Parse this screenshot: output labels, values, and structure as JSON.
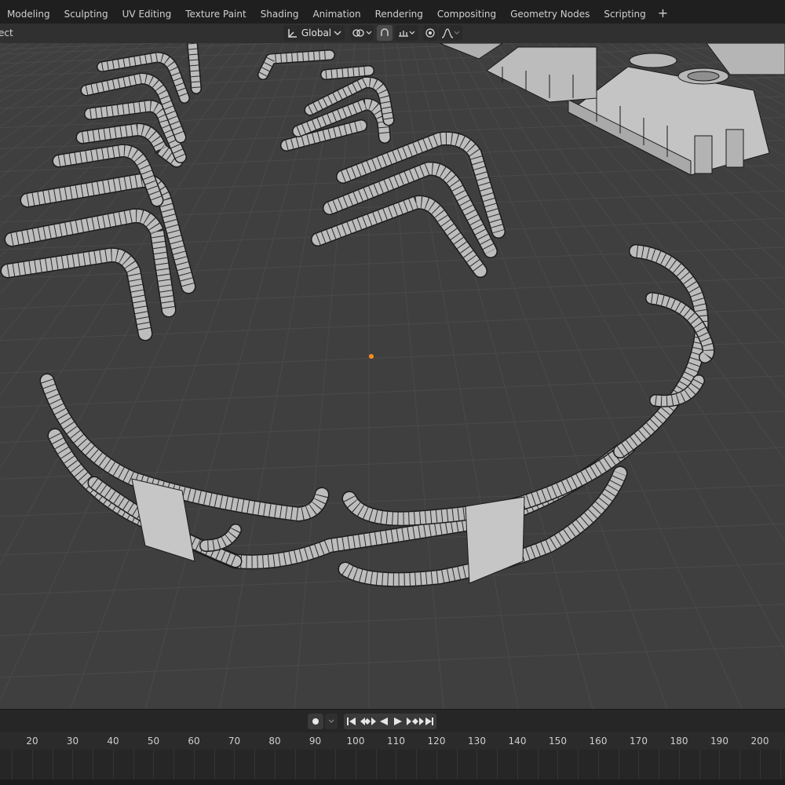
{
  "workspace_tabs": [
    "Modeling",
    "Sculpting",
    "UV Editing",
    "Texture Paint",
    "Shading",
    "Animation",
    "Rendering",
    "Compositing",
    "Geometry Nodes",
    "Scripting"
  ],
  "add_tab_label": "+",
  "header": {
    "mode_text": "ect",
    "transform_orientation": "Global",
    "orientation_icon": "transform-orientation-icon",
    "pivot_icon": "pivot-point-icon",
    "snap_icon": "snap-magnet-icon",
    "snap_target_icon": "snap-increment-icon",
    "proportional_icon": "proportional-editing-icon",
    "falloff_icon": "falloff-curve-icon"
  },
  "timeline": {
    "ticks": [
      "20",
      "30",
      "40",
      "50",
      "60",
      "70",
      "80",
      "90",
      "100",
      "110",
      "120",
      "130",
      "140",
      "150",
      "160",
      "170",
      "180",
      "190",
      "200"
    ],
    "controls": [
      "record-icon",
      "jump-start-icon",
      "prev-keyframe-icon",
      "play-reverse-icon",
      "play-icon",
      "next-keyframe-icon",
      "jump-end-icon"
    ]
  },
  "colors": {
    "topbar": "#1f1f1f",
    "header": "#303030",
    "viewport": "#3f3f3f",
    "grid": "#4a4a4a",
    "mesh": "#bdbdbd",
    "wire": "#1a1a1a",
    "origin": "#ff8c1a"
  }
}
